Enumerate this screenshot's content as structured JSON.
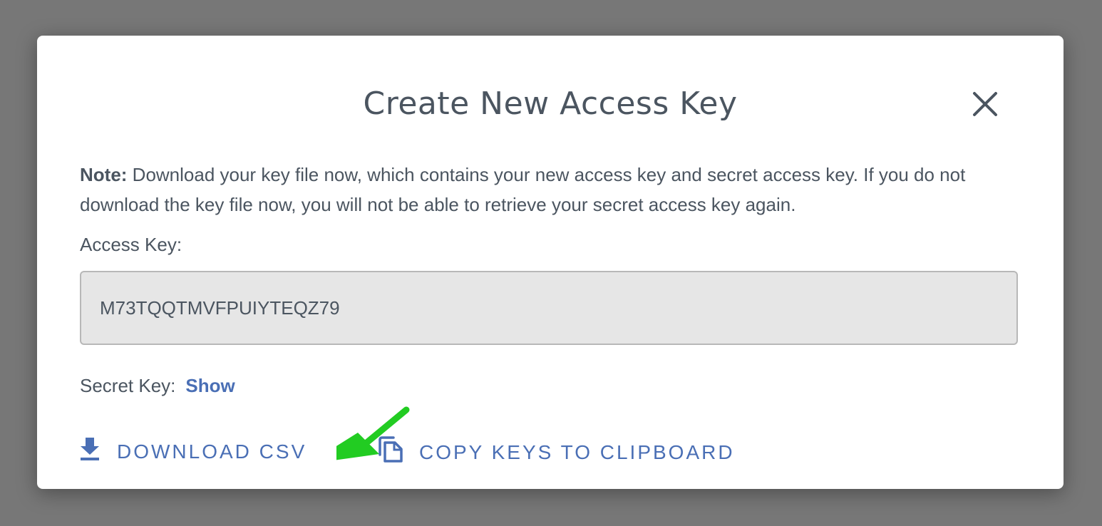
{
  "dialog": {
    "title": "Create New Access Key",
    "note_prefix": "Note:",
    "note_text": " Download your key file now, which contains your new access key and secret access key. If you do not download the key file now, you will not be able to retrieve your secret access key again.",
    "access_key_label": "Access Key:",
    "access_key_value": "M73TQQTMVFPUIYTEQZ79",
    "secret_key_label": "Secret Key:",
    "show_link": "Show",
    "download_label": "DOWNLOAD CSV",
    "copy_label": "COPY KEYS TO CLIPBOARD"
  },
  "icons": {
    "close": "close-icon",
    "download": "download-icon",
    "copy": "copy-icon",
    "annotation": "green-arrow-annotation"
  },
  "colors": {
    "accent": "#4a6fb5",
    "text": "#4b5560",
    "input_bg": "#e6e6e6",
    "backdrop": "#777777",
    "annotation_arrow": "#22cc22"
  }
}
